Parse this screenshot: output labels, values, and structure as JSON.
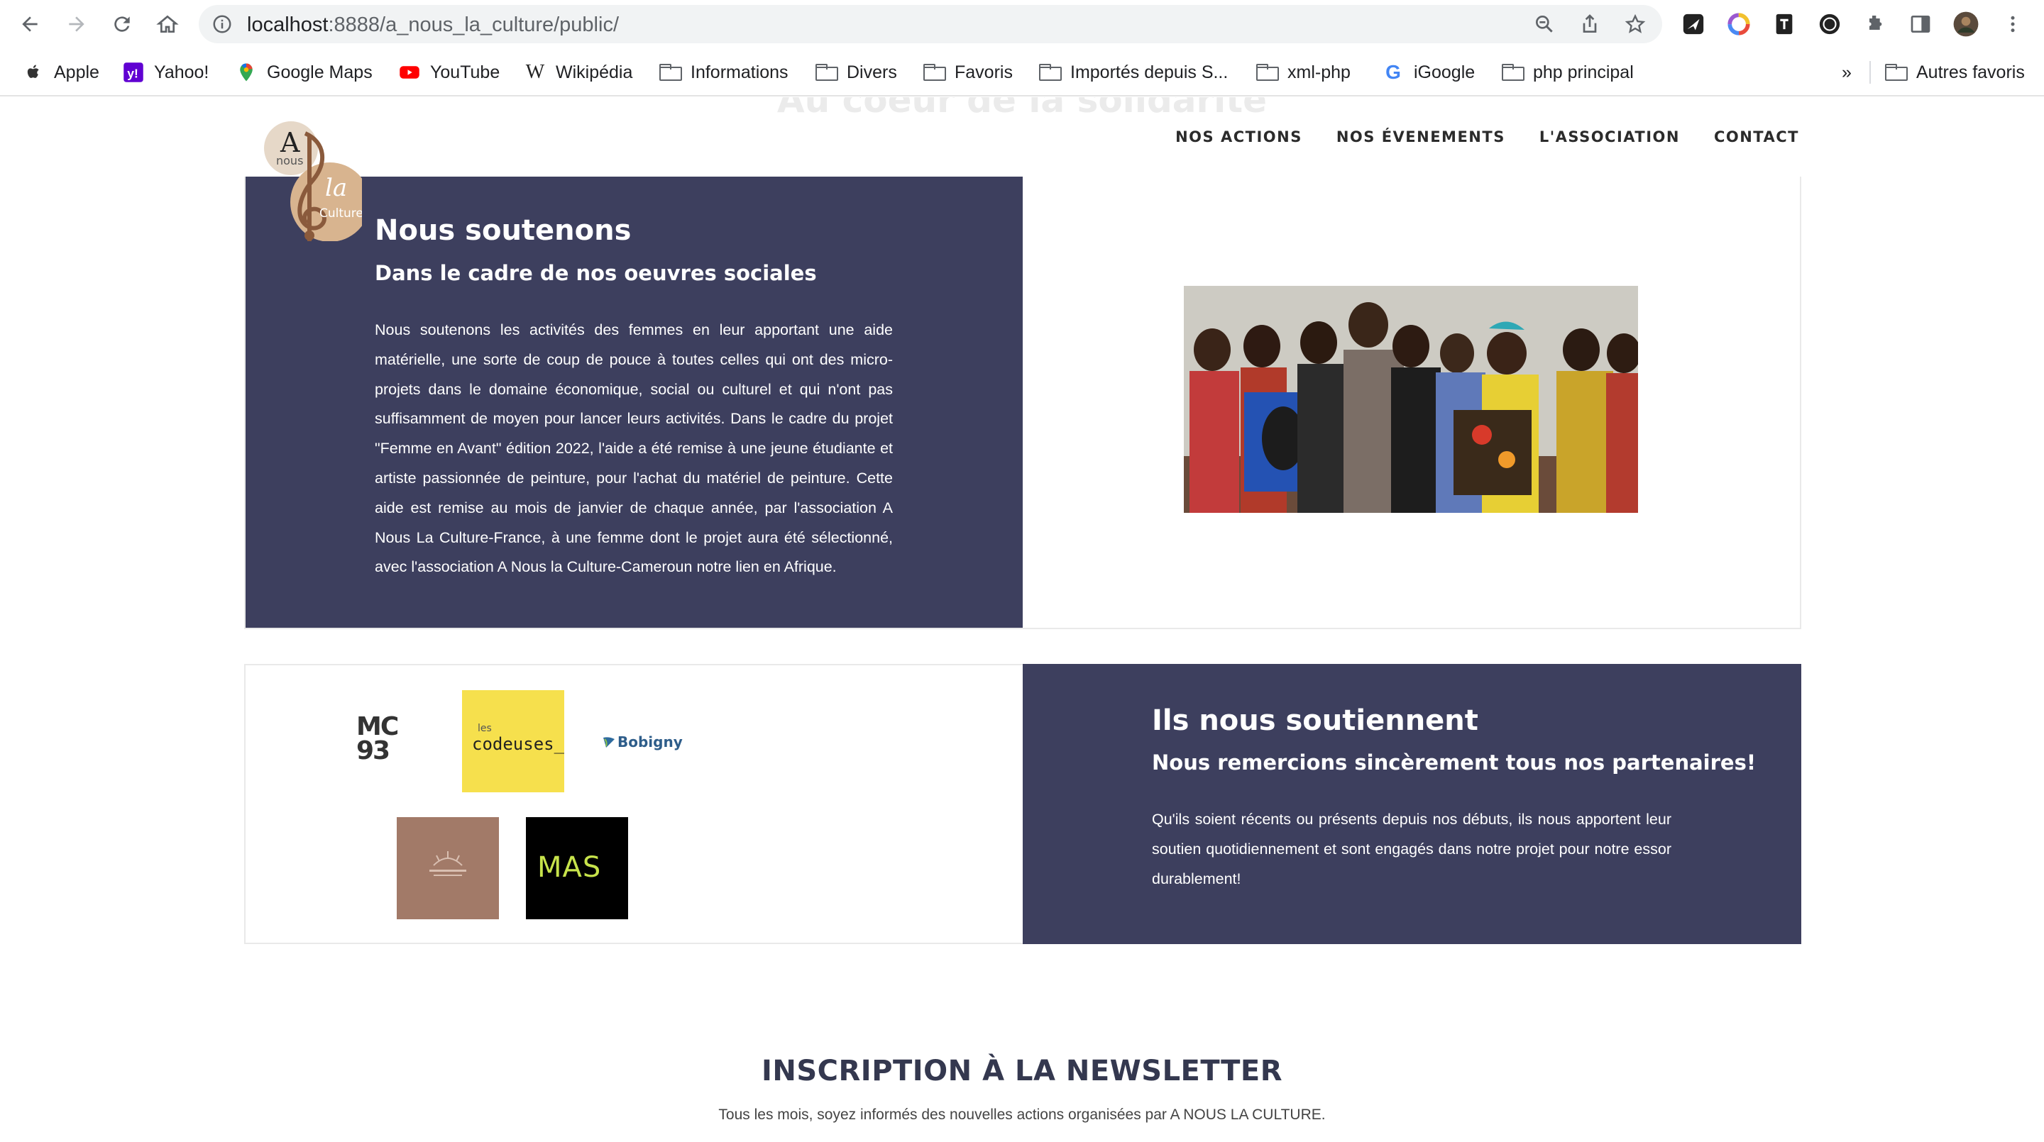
{
  "browser": {
    "url_host": "localhost",
    "url_rest": ":8888/a_nous_la_culture/public/",
    "bookmarks": [
      {
        "label": "Apple",
        "icon": "apple-icon"
      },
      {
        "label": "Yahoo!",
        "icon": "yahoo-icon"
      },
      {
        "label": "Google Maps",
        "icon": "google-maps-icon"
      },
      {
        "label": "YouTube",
        "icon": "youtube-icon"
      },
      {
        "label": "Wikipédia",
        "icon": "wikipedia-icon"
      },
      {
        "label": "Informations",
        "icon": "folder-icon"
      },
      {
        "label": "Divers",
        "icon": "folder-icon"
      },
      {
        "label": "Favoris",
        "icon": "folder-icon"
      },
      {
        "label": "Importés depuis S...",
        "icon": "folder-icon"
      },
      {
        "label": "xml-php",
        "icon": "folder-icon"
      },
      {
        "label": "iGoogle",
        "icon": "google-icon"
      },
      {
        "label": "php principal",
        "icon": "folder-icon"
      }
    ],
    "overflow_label": "»",
    "other_bookmarks": "Autres favoris"
  },
  "site": {
    "ghost_heading": "Au coeur de la solidarité",
    "logo": {
      "a": "A",
      "nous": "nous",
      "la": "la",
      "culture": "Culture"
    },
    "nav": [
      "NOS ACTIONS",
      "NOS ÉVENEMENTS",
      "L'ASSOCIATION",
      "CONTACT"
    ]
  },
  "soutenons": {
    "title": "Nous soutenons",
    "subtitle": "Dans le cadre de nos oeuvres sociales",
    "body": "Nous soutenons les activités des femmes en leur apportant une aide matérielle, une sorte de coup de pouce à toutes celles qui ont des micro-projets dans le domaine économique, social ou culturel et qui n'ont pas suffisamment de moyen pour lancer leurs activités. Dans le cadre du projet \"Femme en Avant\" édition 2022, l'aide a été remise à une jeune étudiante et artiste passionnée de peinture, pour l'achat du matériel de peinture. Cette aide est remise au mois de janvier de chaque année, par l'association A Nous La Culture-France, à une femme dont le projet aura été sélectionné, avec l'association A Nous la Culture-Cameroun notre lien en Afrique."
  },
  "soutiennent": {
    "title": "Ils nous soutiennent",
    "subtitle": "Nous remercions sincèrement tous nos partenaires!",
    "body": "Qu'ils soient récents ou présents depuis nos débuts, ils nous apportent leur soutien quotidiennement et sont engagés dans notre projet pour notre essor durablement!",
    "partners": {
      "mc93": "MC 93",
      "codeuses_small": "les",
      "codeuses": "codeuses_",
      "bobigny": "Bobigny",
      "mas": "MAS"
    }
  },
  "newsletter": {
    "title": "INSCRIPTION À LA NEWSLETTER",
    "text": "Tous les mois, soyez informés des nouvelles actions organisées par A NOUS LA CULTURE."
  },
  "colors": {
    "panel": "#3d3f5e",
    "logo_beige": "#d8b48f",
    "logo_brown": "#8a5a3c",
    "codeuses_yellow": "#f6e04d",
    "mas_green": "#c7e34b"
  }
}
